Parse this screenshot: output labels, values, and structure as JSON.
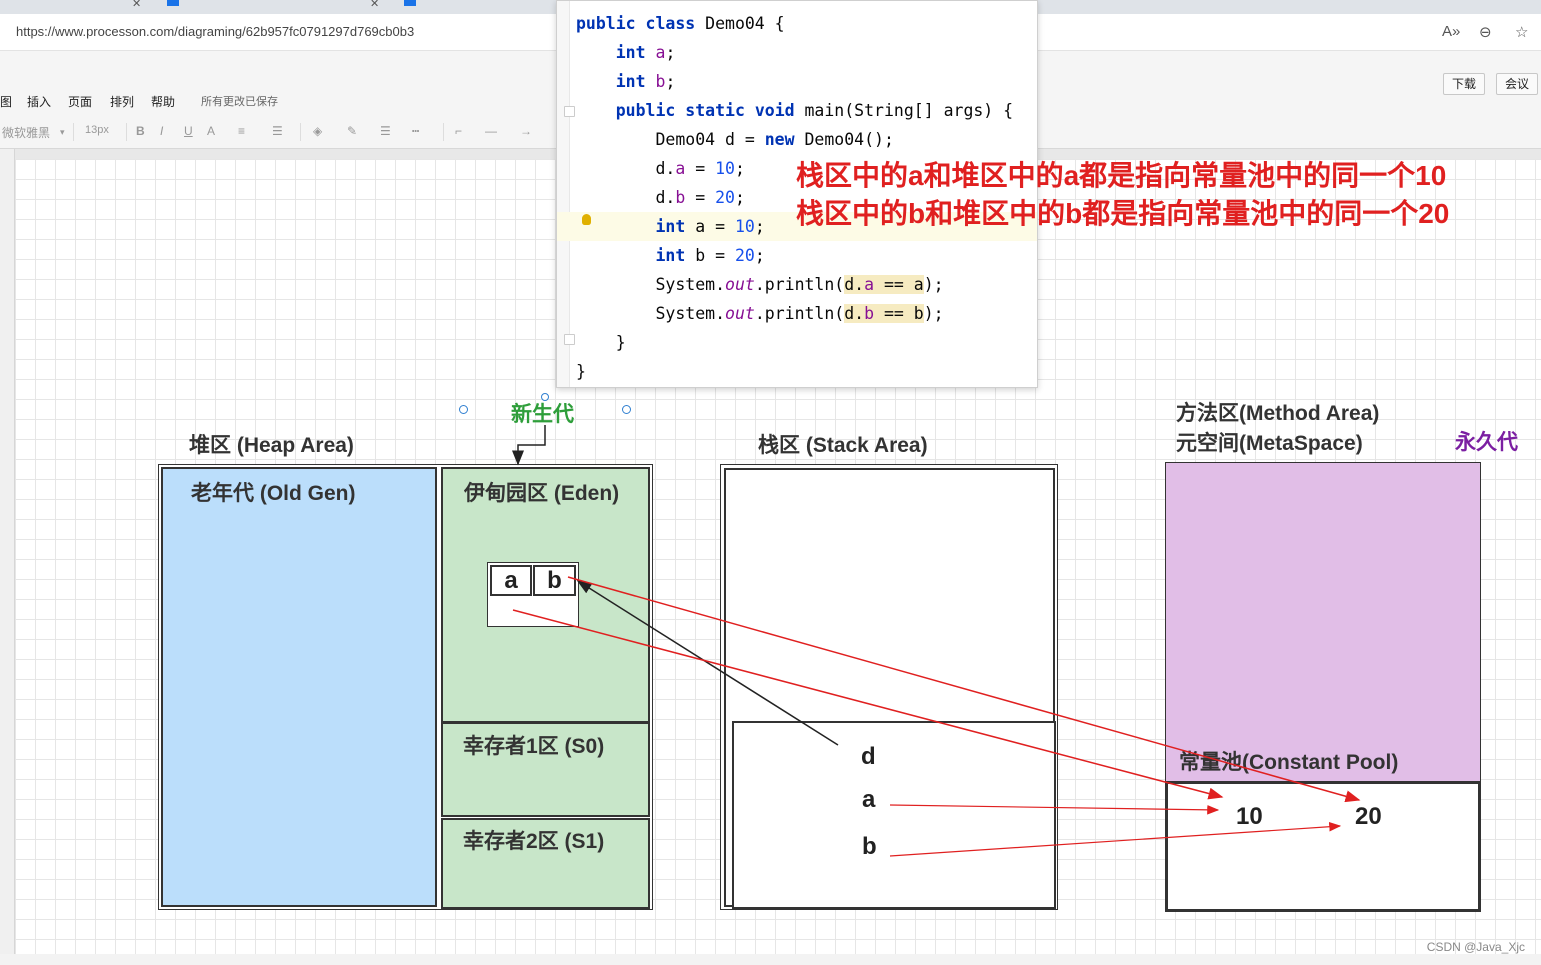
{
  "browser": {
    "url": "https://www.processon.com/diagraming/62b957fc0791297d769cb0b3",
    "icons": [
      "read-aloud-icon",
      "zoom-icon",
      "favorites-icon"
    ]
  },
  "toolbar": {
    "menu_items": [
      "图",
      "插入",
      "页面",
      "排列",
      "帮助"
    ],
    "saved_status": "所有更改已保存",
    "download_label": "下载",
    "meeting_label": "会议",
    "font_name": "微软雅黑",
    "font_size": "13px",
    "format_buttons": [
      "B",
      "I",
      "U",
      "A"
    ]
  },
  "diagram": {
    "heap_title": "堆区 (Heap Area)",
    "young_gen_label": "新生代",
    "old_gen_label": "老年代 (Old Gen)",
    "eden_label": "伊甸园区 (Eden)",
    "s0_label": "幸存者1区 (S0)",
    "s1_label": "幸存者2区 (S1)",
    "object_fields": [
      "a",
      "b"
    ],
    "stack_title": "栈区 (Stack Area)",
    "stack_vars": [
      "d",
      "a",
      "b"
    ],
    "method_area_title": "方法区(Method Area)",
    "metaspace_title": "元空间(MetaSpace)",
    "perm_gen_label": "永久代",
    "constant_pool_label": "常量池(Constant Pool)",
    "constants": [
      "10",
      "20"
    ],
    "colors": {
      "old_gen": "#bbdefb",
      "eden": "#c8e6c9",
      "method_area": "#e1bee7",
      "young_gen_text": "#2e9e3a",
      "perm_gen_text": "#7b1fa2",
      "arrow_red": "#e02020"
    }
  },
  "code": {
    "lines": [
      "public class Demo04 {",
      "    int a;",
      "    int b;",
      "    public static void main(String[] args) {",
      "        Demo04 d = new Demo04();",
      "        d.a = 10;",
      "        d.b = 20;",
      "        int a = 10;",
      "        int b = 20;",
      "        System.out.println(d.a == a);",
      "        System.out.println(d.b == b);",
      "    }",
      "}"
    ]
  },
  "annotations": [
    "栈区中的a和堆区中的a都是指向常量池中的同一个10",
    "栈区中的b和堆区中的b都是指向常量池中的同一个20"
  ],
  "watermark": "CSDN @Java_Xjc"
}
